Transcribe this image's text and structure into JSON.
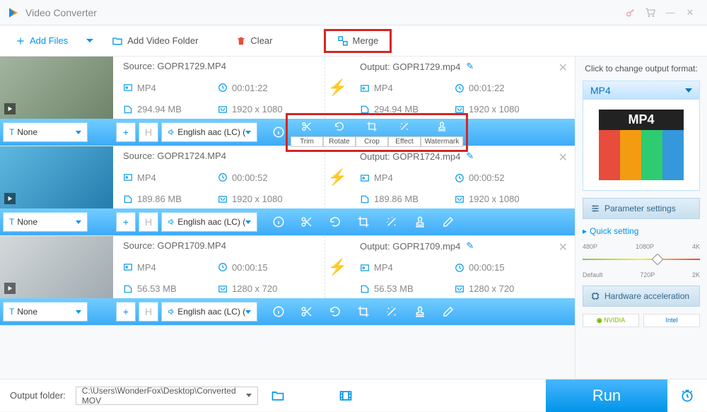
{
  "app": {
    "title": "Video Converter"
  },
  "toolbar": {
    "add_files": "Add Files",
    "add_folder": "Add Video Folder",
    "clear": "Clear",
    "merge": "Merge"
  },
  "edit_tools": {
    "trim": "Trim",
    "rotate": "Rotate",
    "crop": "Crop",
    "effect": "Effect",
    "watermark": "Watermark"
  },
  "files": [
    {
      "source_label": "Source: GOPR1729.MP4",
      "output_label": "Output: GOPR1729.mp4",
      "src_format": "MP4",
      "src_duration": "00:01:22",
      "src_size": "294.94 MB",
      "src_res": "1920 x 1080",
      "out_format": "MP4",
      "out_duration": "00:01:22",
      "out_size": "294.94 MB",
      "out_res": "1920 x 1080",
      "subtitle": "None",
      "audio": "English aac (LC) (mp"
    },
    {
      "source_label": "Source: GOPR1724.MP4",
      "output_label": "Output: GOPR1724.mp4",
      "src_format": "MP4",
      "src_duration": "00:00:52",
      "src_size": "189.86 MB",
      "src_res": "1920 x 1080",
      "out_format": "MP4",
      "out_duration": "00:00:52",
      "out_size": "189.86 MB",
      "out_res": "1920 x 1080",
      "subtitle": "None",
      "audio": "English aac (LC) (mp"
    },
    {
      "source_label": "Source: GOPR1709.MP4",
      "output_label": "Output: GOPR1709.mp4",
      "src_format": "MP4",
      "src_duration": "00:00:15",
      "src_size": "56.53 MB",
      "src_res": "1280 x 720",
      "out_format": "MP4",
      "out_duration": "00:00:15",
      "out_size": "56.53 MB",
      "out_res": "1280 x 720",
      "subtitle": "None",
      "audio": "English aac (LC) (mp"
    }
  ],
  "side": {
    "change_format": "Click to change output format:",
    "format": "MP4",
    "format_art": "MP4",
    "param_settings": "Parameter settings",
    "quick_setting": "Quick setting",
    "ticks_top": {
      "a": "480P",
      "b": "1080P",
      "c": "4K"
    },
    "ticks_bot": {
      "a": "Default",
      "b": "720P",
      "c": "2K"
    },
    "hw_accel": "Hardware acceleration",
    "nvidia": "NVIDIA",
    "intel": "Intel"
  },
  "footer": {
    "out_folder_label": "Output folder:",
    "out_folder_path": "C:\\Users\\WonderFox\\Desktop\\Converted MOV",
    "run": "Run"
  }
}
